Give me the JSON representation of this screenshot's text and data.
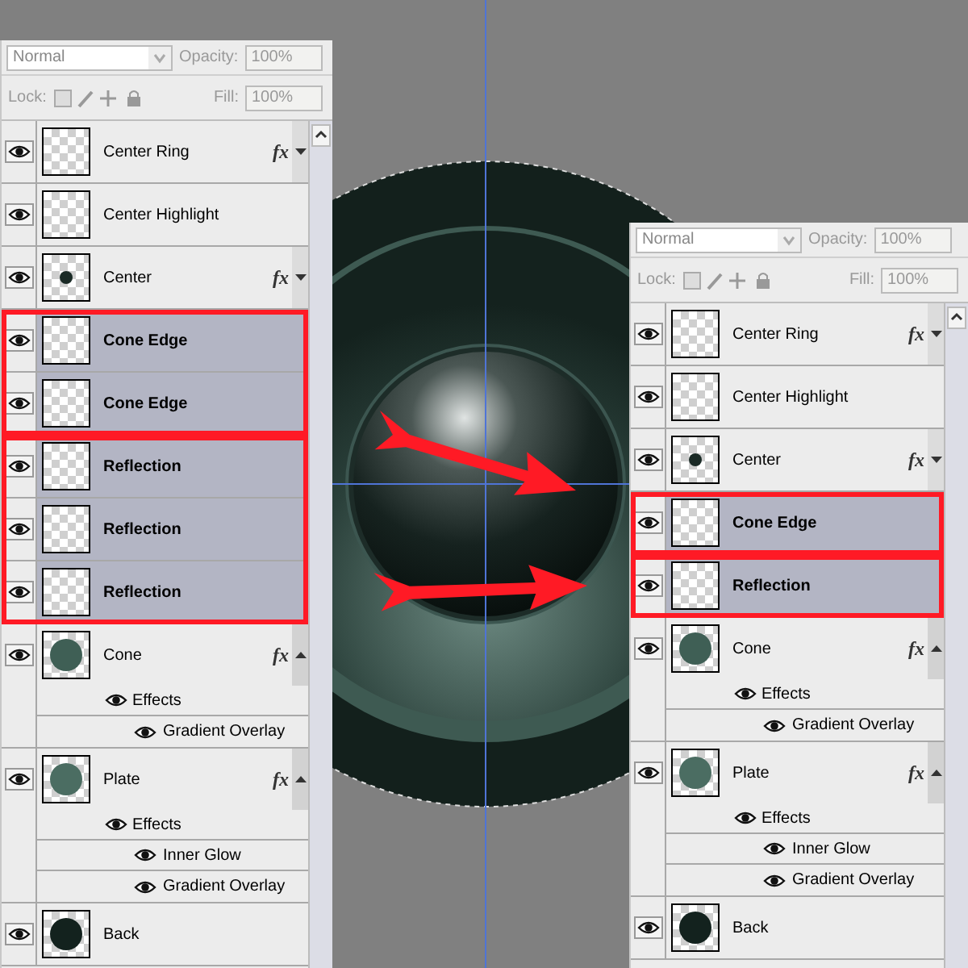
{
  "panels": [
    {
      "blend_mode": "Normal",
      "opacity_label": "Opacity:",
      "opacity": "100%",
      "lock_label": "Lock:",
      "fill_label": "Fill:",
      "fill": "100%",
      "layers": [
        {
          "name": "Center Ring",
          "kind": "blank",
          "visible": true,
          "selected": false,
          "fx": "fx",
          "expanded": false
        },
        {
          "name": "Center Highlight",
          "kind": "blank",
          "visible": true,
          "selected": false
        },
        {
          "name": "Center",
          "kind": "dot",
          "color": "#1a2a26",
          "visible": true,
          "selected": false,
          "fx": "fx",
          "expanded": false
        },
        {
          "callout": [
            {
              "name": "Cone Edge",
              "kind": "blank",
              "visible": true,
              "selected": true
            },
            {
              "name": "Cone Edge",
              "kind": "blank",
              "visible": true,
              "selected": true
            }
          ]
        },
        {
          "callout": [
            {
              "name": "Reflection",
              "kind": "blank",
              "visible": true,
              "selected": true
            },
            {
              "name": "Reflection",
              "kind": "blank",
              "visible": true,
              "selected": true
            },
            {
              "name": "Reflection",
              "kind": "blank",
              "visible": true,
              "selected": true
            }
          ]
        },
        {
          "name": "Cone",
          "kind": "disc",
          "color": "#3f5f55",
          "visible": true,
          "selected": false,
          "fx": "fx",
          "expanded": true,
          "effects_label": "Effects",
          "effects": [
            {
              "name": "Gradient Overlay",
              "visible": true
            }
          ]
        },
        {
          "name": "Plate",
          "kind": "disc",
          "color": "#4b6d62",
          "visible": true,
          "selected": false,
          "fx": "fx",
          "expanded": true,
          "effects_label": "Effects",
          "effects": [
            {
              "name": "Inner Glow",
              "visible": true
            },
            {
              "name": "Gradient Overlay",
              "visible": true
            }
          ]
        },
        {
          "name": "Back",
          "kind": "disc",
          "color": "#13221e",
          "visible": true,
          "selected": false
        }
      ]
    },
    {
      "blend_mode": "Normal",
      "opacity_label": "Opacity:",
      "opacity": "100%",
      "lock_label": "Lock:",
      "fill_label": "Fill:",
      "fill": "100%",
      "layers": [
        {
          "name": "Center Ring",
          "kind": "blank",
          "visible": true,
          "selected": false,
          "fx": "fx",
          "expanded": false
        },
        {
          "name": "Center Highlight",
          "kind": "blank",
          "visible": true,
          "selected": false
        },
        {
          "name": "Center",
          "kind": "dot",
          "color": "#1a2a26",
          "visible": true,
          "selected": false,
          "fx": "fx",
          "expanded": false
        },
        {
          "callout": [
            {
              "name": "Cone Edge",
              "kind": "blank",
              "visible": true,
              "selected": true
            }
          ]
        },
        {
          "callout": [
            {
              "name": "Reflection",
              "kind": "blank",
              "visible": true,
              "selected": true
            }
          ]
        },
        {
          "name": "Cone",
          "kind": "disc",
          "color": "#3f5f55",
          "visible": true,
          "selected": false,
          "fx": "fx",
          "expanded": true,
          "effects_label": "Effects",
          "effects": [
            {
              "name": "Gradient Overlay",
              "visible": true
            }
          ]
        },
        {
          "name": "Plate",
          "kind": "disc",
          "color": "#4b6d62",
          "visible": true,
          "selected": false,
          "fx": "fx",
          "expanded": true,
          "effects_label": "Effects",
          "effects": [
            {
              "name": "Inner Glow",
              "visible": true
            },
            {
              "name": "Gradient Overlay",
              "visible": true
            }
          ]
        },
        {
          "name": "Back",
          "kind": "disc",
          "color": "#13221e",
          "visible": true,
          "selected": false
        }
      ]
    }
  ]
}
